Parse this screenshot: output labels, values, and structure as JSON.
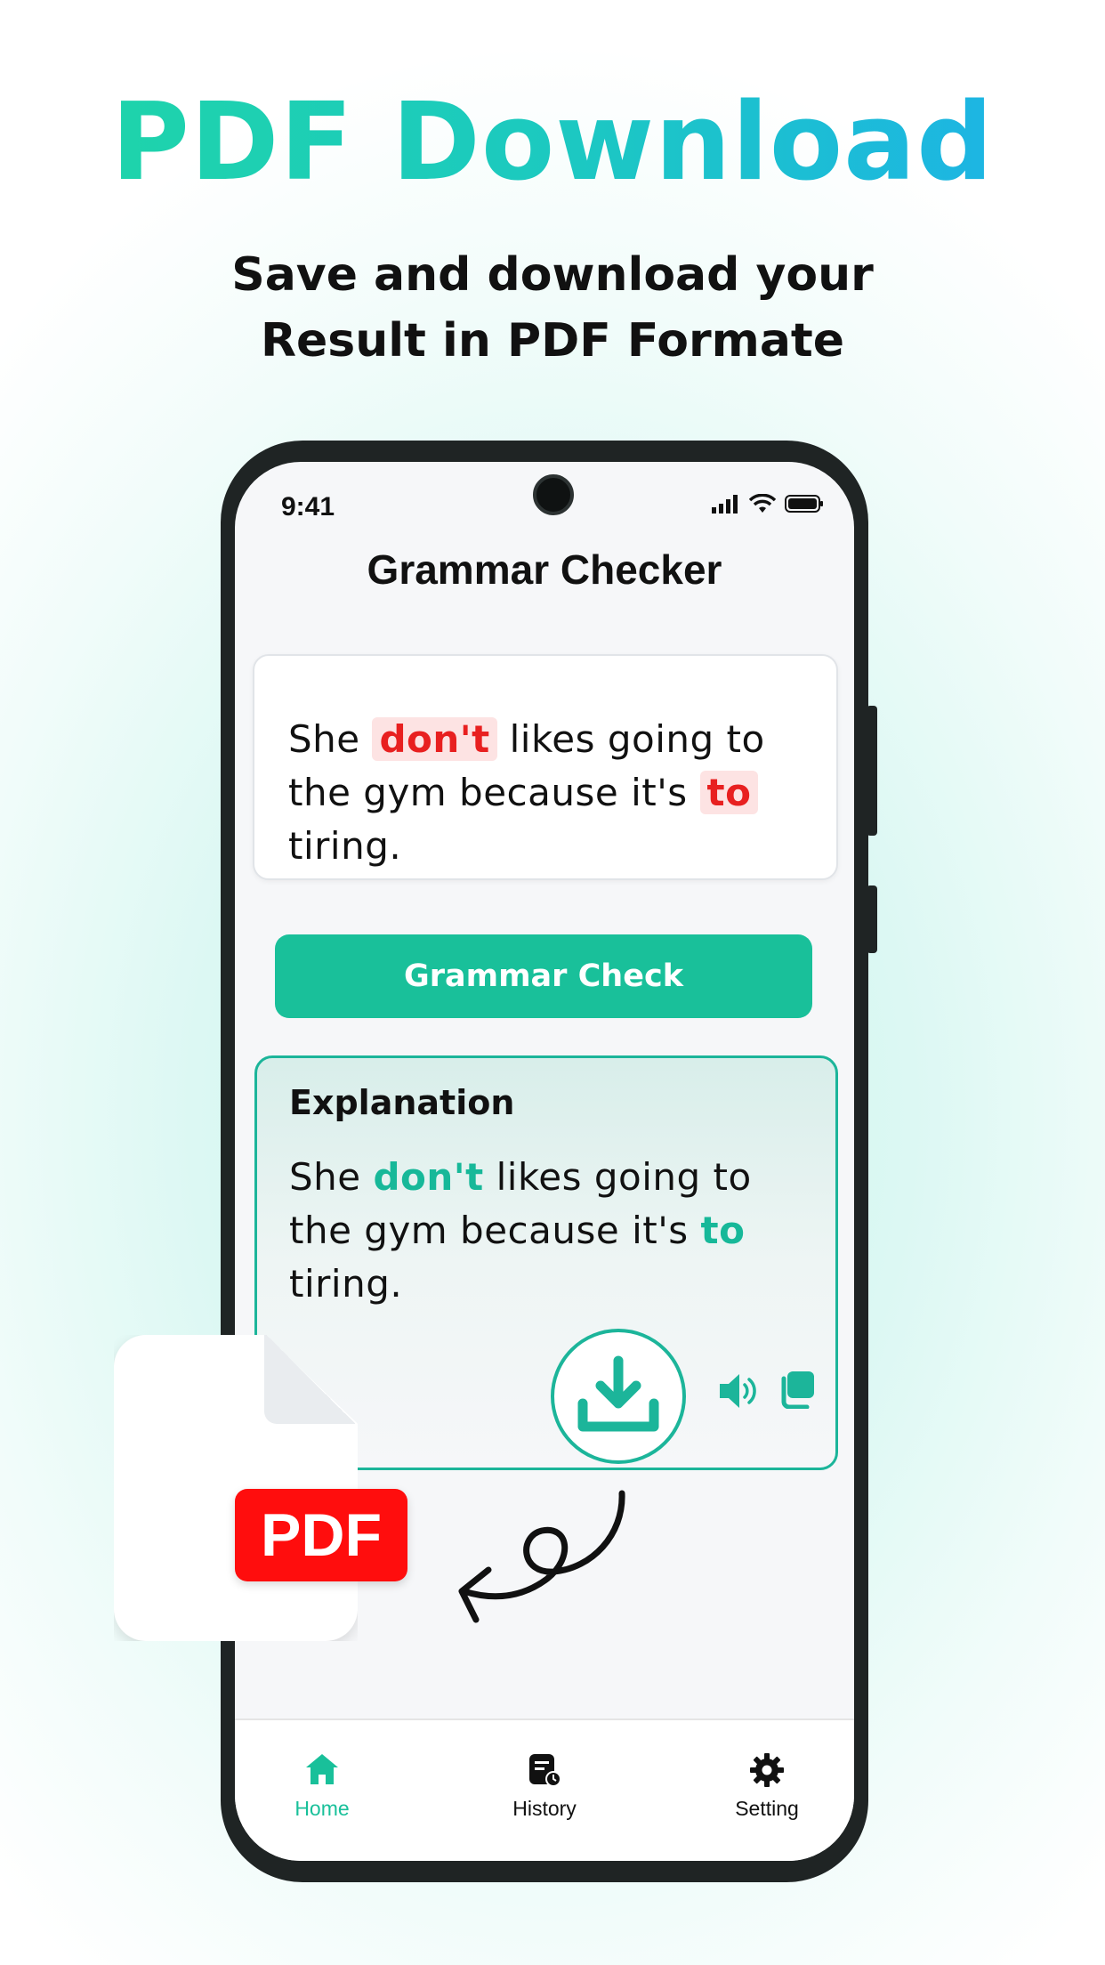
{
  "promo": {
    "headline": "PDF Download",
    "subline_1": "Save and download your",
    "subline_2": "Result in PDF Formate"
  },
  "status_bar": {
    "time": "9:41"
  },
  "app": {
    "title": "Grammar Checker",
    "input_sentence": {
      "before_1": "She ",
      "error_1": "don't",
      "middle": " likes going to the gym because it's ",
      "error_2": "to",
      "after": " tiring."
    },
    "check_button_label": "Grammar Check",
    "explanation": {
      "title": "Explanation",
      "before_1": "She ",
      "highlight_1": "don't",
      "middle": " likes going to the gym because it's ",
      "highlight_2": "to",
      "after": " tiring."
    },
    "actions": [
      "download-icon",
      "speaker-icon",
      "copy-icon"
    ]
  },
  "tab_bar": {
    "items": [
      {
        "label": "Home",
        "icon": "home-icon",
        "active": true
      },
      {
        "label": "History",
        "icon": "history-icon",
        "active": false
      },
      {
        "label": "Setting",
        "icon": "gear-icon",
        "active": false
      }
    ]
  },
  "pdf_graphic": {
    "badge": "PDF"
  },
  "colors": {
    "accent": "#19c09a",
    "error": "#e82020",
    "error_bg": "#fde3e3",
    "pdf_red": "#ff0d0d",
    "gradient_start": "#1fd6a6",
    "gradient_end": "#1db0ec"
  }
}
